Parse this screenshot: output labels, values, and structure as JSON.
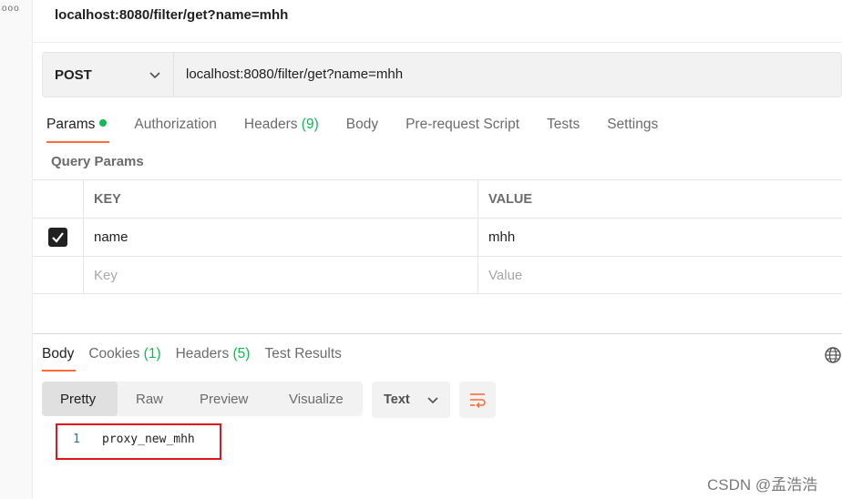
{
  "sidebar": {
    "menu_glyph": "ooo"
  },
  "request": {
    "title": "localhost:8080/filter/get?name=mhh",
    "method": "POST",
    "url": "localhost:8080/filter/get?name=mhh"
  },
  "tabs": {
    "params": "Params",
    "authorization": "Authorization",
    "headers_label": "Headers",
    "headers_count": "(9)",
    "body": "Body",
    "prerequest": "Pre-request Script",
    "tests": "Tests",
    "settings": "Settings"
  },
  "query_params": {
    "title": "Query Params",
    "columns": {
      "key": "KEY",
      "value": "VALUE"
    },
    "rows": [
      {
        "checked": true,
        "key": "name",
        "value": "mhh"
      }
    ],
    "placeholder": {
      "key": "Key",
      "value": "Value"
    }
  },
  "response": {
    "tabs": {
      "body": "Body",
      "cookies_label": "Cookies",
      "cookies_count": "(1)",
      "headers_label": "Headers",
      "headers_count": "(5)",
      "test_results": "Test Results"
    },
    "views": [
      "Pretty",
      "Raw",
      "Preview",
      "Visualize"
    ],
    "active_view": "Pretty",
    "format": "Text",
    "lines": [
      {
        "num": "1",
        "text": "proxy_new_mhh"
      }
    ]
  },
  "colors": {
    "accent": "#ff6c37",
    "green": "#0cbb52",
    "highlight_box": "#e0151e"
  },
  "icons": [
    "chevron-down-icon",
    "globe-icon",
    "wrap-lines-icon",
    "checkmark-icon"
  ],
  "watermark": "CSDN @孟浩浩"
}
